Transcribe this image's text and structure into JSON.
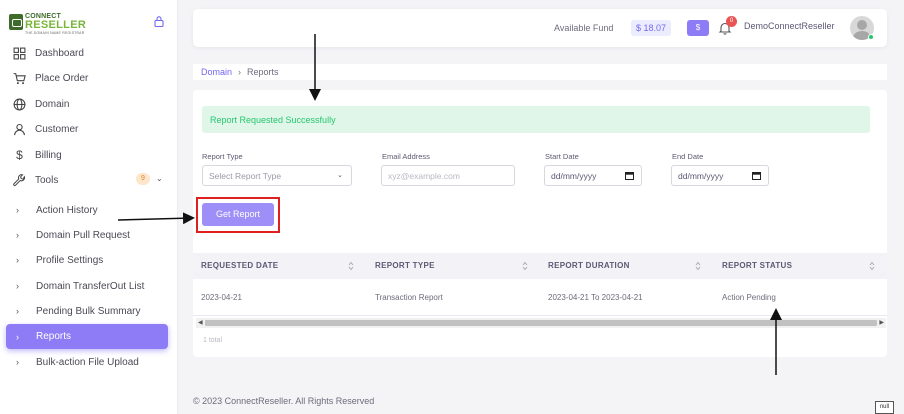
{
  "brand": {
    "line1": "CONNECT",
    "line2": "RESELLER",
    "tagline": "THE DOMAIN NAME REGISTRAR"
  },
  "sidebar": {
    "items": [
      {
        "label": "Dashboard",
        "icon": "grid-icon"
      },
      {
        "label": "Place Order",
        "icon": "cart-icon"
      },
      {
        "label": "Domain",
        "icon": "globe-icon"
      },
      {
        "label": "Customer",
        "icon": "user-icon"
      },
      {
        "label": "Billing",
        "icon": "dollar-icon"
      },
      {
        "label": "Tools",
        "icon": "wrench-icon",
        "badge": "9"
      }
    ],
    "tools_submenu": [
      {
        "label": "Action History"
      },
      {
        "label": "Domain Pull Request"
      },
      {
        "label": "Profile Settings"
      },
      {
        "label": "Domain TransferOut List"
      },
      {
        "label": "Pending Bulk Summary"
      },
      {
        "label": "Reports",
        "active": true
      },
      {
        "label": "Bulk-action File Upload"
      }
    ]
  },
  "header": {
    "fund_label": "Available Fund",
    "fund_value": "$ 18.07",
    "dollar_button": "$",
    "notification_count": "0",
    "user_name": "DemoConnectReseller"
  },
  "breadcrumb": {
    "parent": "Domain",
    "separator": "›",
    "current": "Reports"
  },
  "alert": {
    "message": "Report Requested Successfully"
  },
  "form": {
    "report_type_label": "Report Type",
    "report_type_placeholder": "Select Report Type",
    "email_label": "Email Address",
    "email_placeholder": "xyz@example.com",
    "start_date_label": "Start Date",
    "start_date_value": "dd/mm/yyyy",
    "end_date_label": "End Date",
    "end_date_value": "dd/mm/yyyy",
    "submit_label": "Get Report"
  },
  "table": {
    "columns": [
      "REQUESTED DATE",
      "REPORT TYPE",
      "REPORT DURATION",
      "REPORT STATUS"
    ],
    "rows": [
      [
        "2023-04-21",
        "Transaction Report",
        "2023-04-21 To 2023-04-21",
        "Action Pending"
      ]
    ],
    "total_text": "1 total"
  },
  "footer": {
    "copyright": "© 2023 ConnectReseller. All Rights Reserved",
    "null_label": "null"
  },
  "colors": {
    "accent": "#7367f0",
    "active_bg": "#8d7cf6",
    "success": "#28c76f",
    "highlight": "#e0201f"
  }
}
